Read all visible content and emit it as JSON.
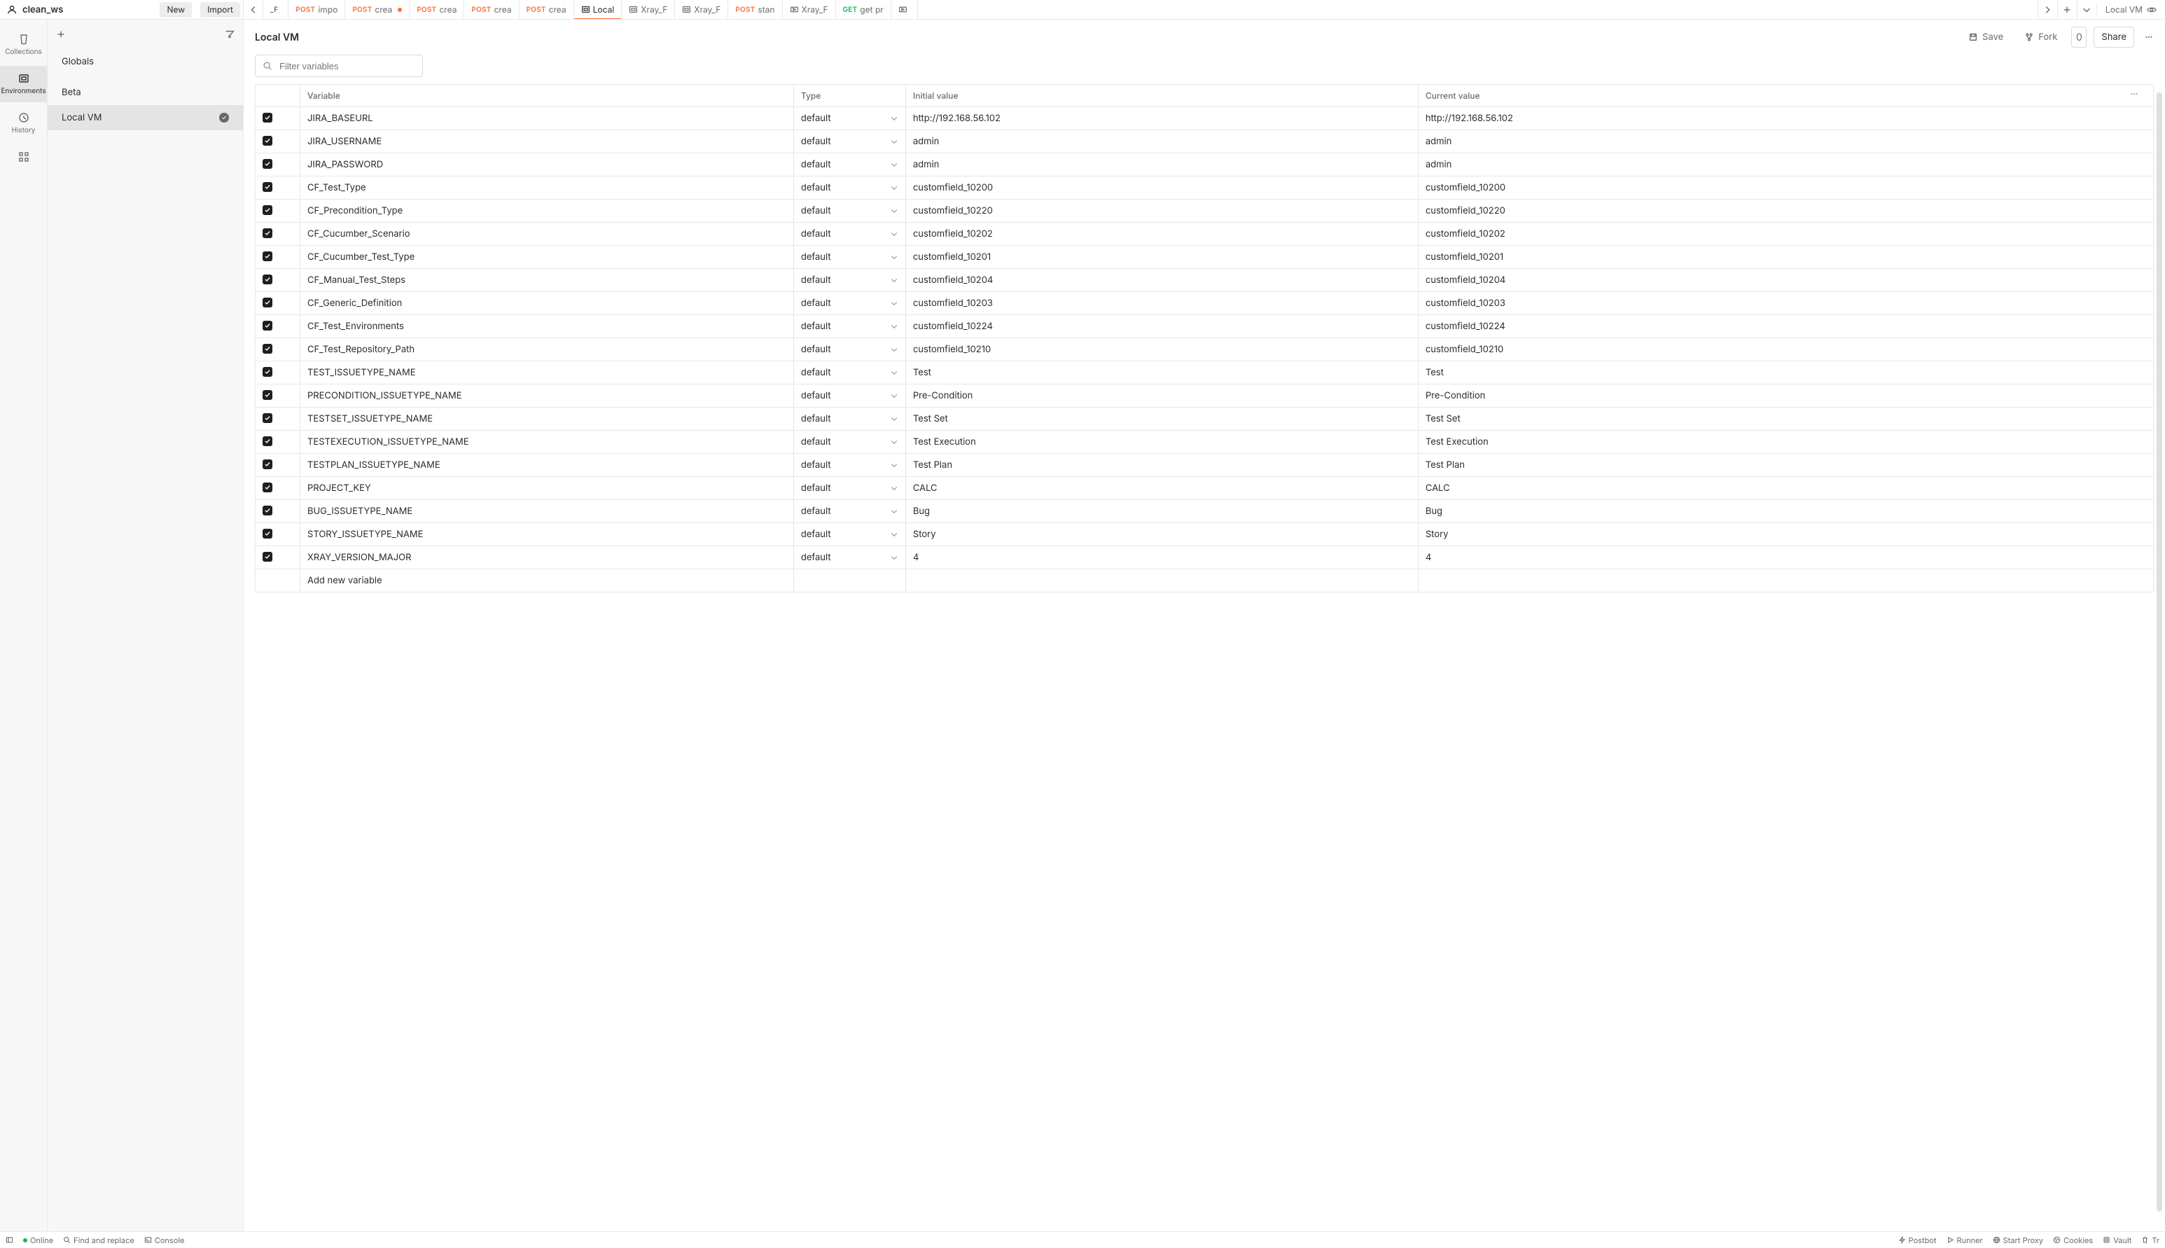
{
  "workspace": {
    "name": "clean_ws",
    "btn_new": "New",
    "btn_import": "Import"
  },
  "rail": {
    "collections": "Collections",
    "environments": "Environments",
    "history": "History"
  },
  "tabs": [
    {
      "kind": "method",
      "method": "_F",
      "label": "",
      "mcls": ""
    },
    {
      "kind": "method",
      "method": "POST",
      "label": "impo",
      "mcls": "post"
    },
    {
      "kind": "method",
      "method": "POST",
      "label": "crea",
      "mcls": "post",
      "dot": true
    },
    {
      "kind": "method",
      "method": "POST",
      "label": "crea",
      "mcls": "post"
    },
    {
      "kind": "method",
      "method": "POST",
      "label": "crea",
      "mcls": "post"
    },
    {
      "kind": "method",
      "method": "POST",
      "label": "crea",
      "mcls": "post"
    },
    {
      "kind": "icon",
      "icon": "env",
      "label": "Local",
      "active": true
    },
    {
      "kind": "icon",
      "icon": "env",
      "label": "Xray_F"
    },
    {
      "kind": "icon",
      "icon": "env",
      "label": "Xray_F"
    },
    {
      "kind": "method",
      "method": "POST",
      "label": "stan",
      "mcls": "post"
    },
    {
      "kind": "icon",
      "icon": "flow",
      "label": "Xray_F"
    },
    {
      "kind": "method",
      "method": "GET",
      "label": "get pr",
      "mcls": "get"
    },
    {
      "kind": "icon",
      "icon": "flow",
      "label": ""
    }
  ],
  "env_indicator": "Local VM",
  "sidebar": {
    "globals": "Globals",
    "envs": [
      {
        "name": "Beta",
        "active": false
      },
      {
        "name": "Local VM",
        "active": true
      }
    ]
  },
  "page_title": "Local VM",
  "actions": {
    "save": "Save",
    "fork": "Fork",
    "fork_count": "0",
    "share": "Share"
  },
  "filter_placeholder": "Filter variables",
  "columns": {
    "variable": "Variable",
    "type": "Type",
    "initial": "Initial value",
    "current": "Current value"
  },
  "type_default": "default",
  "add_new": "Add new variable",
  "rows": [
    {
      "v": "JIRA_BASEURL",
      "i": "http://192.168.56.102",
      "c": "http://192.168.56.102"
    },
    {
      "v": "JIRA_USERNAME",
      "i": "admin",
      "c": "admin"
    },
    {
      "v": "JIRA_PASSWORD",
      "i": "admin",
      "c": "admin"
    },
    {
      "v": "CF_Test_Type",
      "i": "customfield_10200",
      "c": "customfield_10200"
    },
    {
      "v": "CF_Precondition_Type",
      "i": "customfield_10220",
      "c": "customfield_10220"
    },
    {
      "v": "CF_Cucumber_Scenario",
      "i": "customfield_10202",
      "c": "customfield_10202"
    },
    {
      "v": "CF_Cucumber_Test_Type",
      "i": "customfield_10201",
      "c": "customfield_10201"
    },
    {
      "v": "CF_Manual_Test_Steps",
      "i": "customfield_10204",
      "c": "customfield_10204"
    },
    {
      "v": "CF_Generic_Definition",
      "i": "customfield_10203",
      "c": "customfield_10203"
    },
    {
      "v": "CF_Test_Environments",
      "i": "customfield_10224",
      "c": "customfield_10224"
    },
    {
      "v": "CF_Test_Repository_Path",
      "i": "customfield_10210",
      "c": "customfield_10210"
    },
    {
      "v": "TEST_ISSUETYPE_NAME",
      "i": "Test",
      "c": "Test"
    },
    {
      "v": "PRECONDITION_ISSUETYPE_NAME",
      "i": "Pre-Condition",
      "c": "Pre-Condition"
    },
    {
      "v": "TESTSET_ISSUETYPE_NAME",
      "i": "Test Set",
      "c": "Test Set"
    },
    {
      "v": "TESTEXECUTION_ISSUETYPE_NAME",
      "i": "Test Execution",
      "c": "Test Execution"
    },
    {
      "v": "TESTPLAN_ISSUETYPE_NAME",
      "i": "Test Plan",
      "c": "Test Plan"
    },
    {
      "v": "PROJECT_KEY",
      "i": "CALC",
      "c": "CALC"
    },
    {
      "v": "BUG_ISSUETYPE_NAME",
      "i": "Bug",
      "c": "Bug"
    },
    {
      "v": "STORY_ISSUETYPE_NAME",
      "i": "Story",
      "c": "Story"
    },
    {
      "v": "XRAY_VERSION_MAJOR",
      "i": "4",
      "c": "4"
    }
  ],
  "status": {
    "online": "Online",
    "find": "Find and replace",
    "console": "Console",
    "postbot": "Postbot",
    "runner": "Runner",
    "proxy": "Start Proxy",
    "cookies": "Cookies",
    "vault": "Vault",
    "trash": "Tr"
  }
}
